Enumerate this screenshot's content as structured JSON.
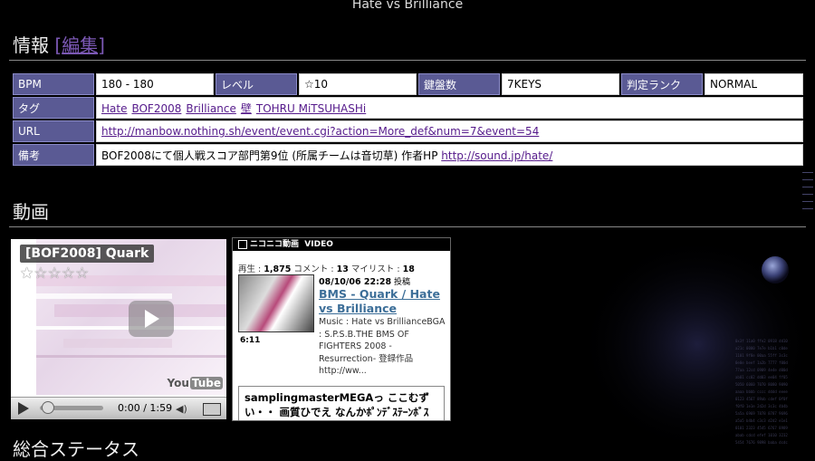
{
  "page_title": "Hate vs Brilliance",
  "sections": {
    "info": "情報",
    "edit_open": "[",
    "edit_link": "編集",
    "edit_close": "]",
    "video": "動画",
    "status": "総合ステータス"
  },
  "info_table": {
    "bpm_label": "BPM",
    "bpm_value": "180 - 180",
    "level_label": "レベル",
    "level_value": "☆10",
    "keys_label": "鍵盤数",
    "keys_value": "7KEYS",
    "judge_label": "判定ランク",
    "judge_value": "NORMAL",
    "tag_label": "タグ",
    "tags": [
      "Hate",
      "BOF2008",
      "Brilliance",
      "壁",
      "TOHRU MiTSUHASHi"
    ],
    "url_label": "URL",
    "url_value": "http://manbow.nothing.sh/event/event.cgi?action=More_def&num=7&event=54",
    "note_label": "備考",
    "note_text": "BOF2008にて個人戦スコア部門第9位 (所属チームは音切草) 作者HP ",
    "note_link": "http://sound.jp/hate/"
  },
  "youtube": {
    "title": "[BOF2008] Quark",
    "stars": "★☆☆☆☆",
    "time": "0:00 / 1:59",
    "logo_you": "You",
    "logo_tube": "Tube"
  },
  "nicovideo": {
    "header_brand": "ニコニコ動画",
    "header_label": "VIDEO",
    "views_label": "再生 : ",
    "views": "1,875",
    "comments_label": " コメント : ",
    "comments": "13",
    "mylist_label": " マイリスト : ",
    "mylist": "18",
    "date": "08/10/06 22:28",
    "posted": " 投稿",
    "title": "BMS - Quark / Hate vs Brilliance",
    "duration": "6:11",
    "description": "Music : Hate vs BrillianceBGA : S.P.S.B.THE BMS OF FIGHTERS 2008 -Resurrection- 登録作品 http://ww...",
    "comment": "samplingmasterMEGAっ ここむずい・・ 画質ひでえ なんかﾎﾟﾝﾃﾞｽﾃｰﾝﾎﾞｽ"
  },
  "colors": {
    "background": "#000000",
    "label_cell": "#5a5a94",
    "value_cell": "#ffffff",
    "link": "#551a8b",
    "edit_link": "#7b58b4",
    "nico_title": "#3c6e98"
  }
}
